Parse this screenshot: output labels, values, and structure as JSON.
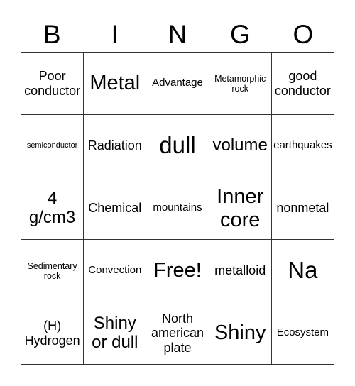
{
  "header": {
    "letters": [
      "B",
      "I",
      "N",
      "G",
      "O"
    ]
  },
  "cells": [
    [
      "Poor conductor",
      "Metal",
      "Advantage",
      "Metamorphic rock",
      "good conductor"
    ],
    [
      "semiconductor",
      "Radiation",
      "dull",
      "volume",
      "earthquakes"
    ],
    [
      "4 g/cm3",
      "Chemical",
      "mountains",
      "Inner core",
      "nonmetal"
    ],
    [
      "Sedimentary rock",
      "Convection",
      "Free!",
      "metalloid",
      "Na"
    ],
    [
      "(H) Hydrogen",
      "Shiny or dull",
      "North american plate",
      "Shiny",
      "Ecosystem"
    ]
  ]
}
